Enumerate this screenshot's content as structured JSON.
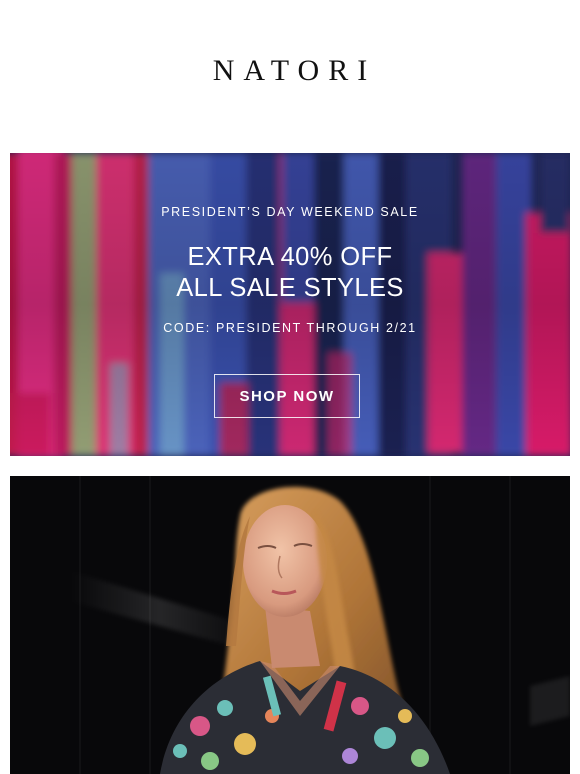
{
  "brand": {
    "logo_text": "NATORI"
  },
  "hero": {
    "eyebrow": "PRESIDENT’S DAY WEEKEND SALE",
    "headline_line1": "EXTRA 40% OFF",
    "headline_line2": "ALL SALE STYLES",
    "code_text": "CODE: PRESIDENT THROUGH 2/21",
    "cta_label": "SHOP NOW",
    "palette": {
      "navy": "#1c2552",
      "blue": "#3a4fb0",
      "magenta": "#e0207a",
      "pink": "#f23f9a",
      "red": "#c41446",
      "sage": "#9aa67a",
      "text": "#ffffff"
    }
  },
  "photo": {
    "background_color": "#08080a",
    "subject": "woman-in-printed-shirt"
  }
}
